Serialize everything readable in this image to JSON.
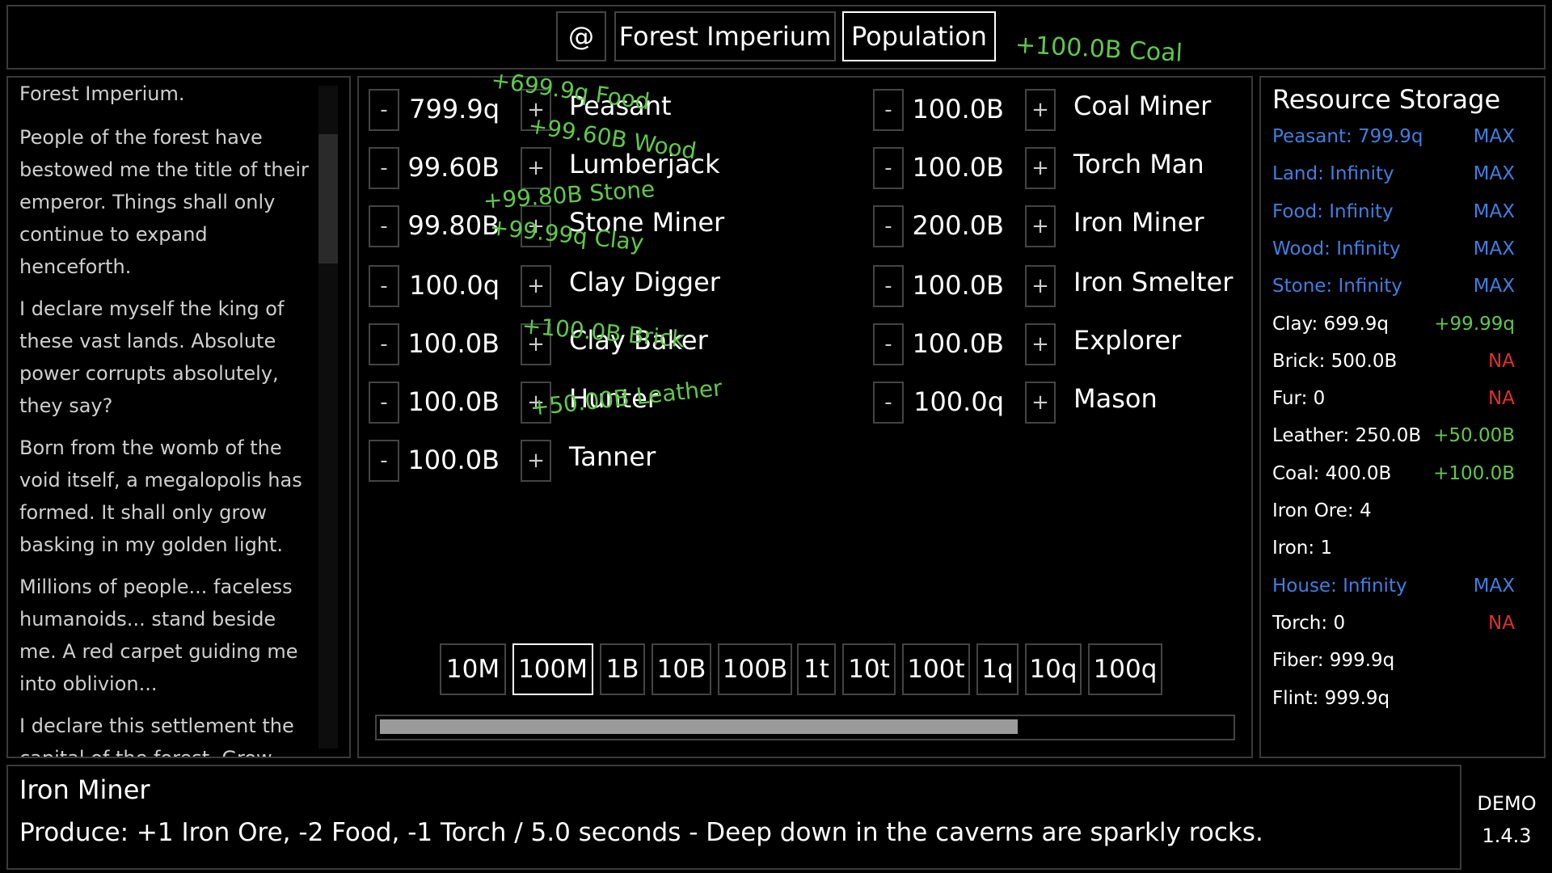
{
  "tabs": {
    "at": "@",
    "settlement": "Forest Imperium",
    "population": "Population"
  },
  "top_float": "+100.0B Coal",
  "story": {
    "title": "Forest Imperium.",
    "paragraphs": [
      "People of the forest have bestowed me the title of their emperor. Things shall only continue to expand henceforth.",
      "I declare myself the king of these vast lands. Absolute power corrupts absolutely, they say?",
      "Born from the womb of the void itself, a megalopolis has formed. It shall only grow basking in my golden light.",
      "Millions of people... faceless humanoids... stand beside me. A red carpet guiding me into oblivion...",
      "I declare this settlement the capital of the forest. Grow beyond this pestilent place and carve our name into this world"
    ]
  },
  "controls": {
    "minus": "-",
    "plus": "+"
  },
  "jobs_left": [
    {
      "name": "Peasant",
      "count": "799.9q"
    },
    {
      "name": "Lumberjack",
      "count": "99.60B"
    },
    {
      "name": "Stone Miner",
      "count": "99.80B"
    },
    {
      "name": "Clay Digger",
      "count": "100.0q"
    },
    {
      "name": "Clay Baker",
      "count": "100.0B"
    },
    {
      "name": "Hunter",
      "count": "100.0B"
    },
    {
      "name": "Tanner",
      "count": "100.0B"
    }
  ],
  "jobs_right": [
    {
      "name": "Coal Miner",
      "count": "100.0B"
    },
    {
      "name": "Torch Man",
      "count": "100.0B"
    },
    {
      "name": "Iron Miner",
      "count": "200.0B"
    },
    {
      "name": "Iron Smelter",
      "count": "100.0B"
    },
    {
      "name": "Explorer",
      "count": "100.0B"
    },
    {
      "name": "Mason",
      "count": "100.0q"
    }
  ],
  "floats": [
    "+699.9q Food",
    "+99.60B Wood",
    "+99.80B Stone",
    "+99.99q Clay",
    "+100.0B Brick",
    "+50.00B Leather"
  ],
  "multipliers": [
    "10M",
    "100M",
    "1B",
    "10B",
    "100B",
    "1t",
    "10t",
    "100t",
    "1q",
    "10q",
    "100q"
  ],
  "multiplier_selected": "100M",
  "progress": 0.75,
  "resources": {
    "title": "Resource Storage",
    "items": [
      {
        "label": "Peasant: 799.9q",
        "tag": "MAX"
      },
      {
        "label": "Land: Infinity",
        "tag": "MAX"
      },
      {
        "label": "Food: Infinity",
        "tag": "MAX"
      },
      {
        "label": "Wood: Infinity",
        "tag": "MAX"
      },
      {
        "label": "Stone: Infinity",
        "tag": "MAX"
      },
      {
        "label": "Clay: 699.9q",
        "tag": "+99.99q"
      },
      {
        "label": "Brick: 500.0B",
        "tag": "NA"
      },
      {
        "label": "Fur: 0",
        "tag": "NA"
      },
      {
        "label": "Leather: 250.0B",
        "tag": "+50.00B"
      },
      {
        "label": "Coal: 400.0B",
        "tag": "+100.0B"
      },
      {
        "label": "Iron Ore: 4",
        "tag": ""
      },
      {
        "label": "Iron: 1",
        "tag": ""
      },
      {
        "label": "House: Infinity",
        "tag": "MAX"
      },
      {
        "label": "Torch: 0",
        "tag": "NA"
      },
      {
        "label": "Fiber: 999.9q",
        "tag": ""
      },
      {
        "label": "Flint: 999.9q",
        "tag": ""
      }
    ]
  },
  "colors": {
    "max_blue": "#3f7fe0",
    "na_red": "#e03030",
    "gain_green": "#5fc84a",
    "text_white": "#ffffff",
    "border": "#3a3a3a"
  },
  "info": {
    "title": "Iron Miner",
    "description": "Produce: +1 Iron Ore, -2 Food, -1 Torch / 5.0 seconds - Deep down in the caverns are sparkly rocks."
  },
  "build": {
    "demo": "DEMO",
    "version": "1.4.3"
  }
}
